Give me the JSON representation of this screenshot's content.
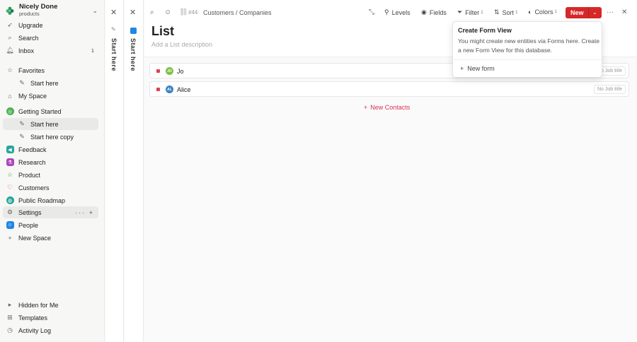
{
  "workspace": {
    "name": "Nicely Done",
    "subtitle": "products"
  },
  "sidebar": {
    "top_items": [
      {
        "label": "Upgrade",
        "icon": "rocket-icon"
      },
      {
        "label": "Search",
        "icon": "search-icon"
      },
      {
        "label": "Inbox",
        "icon": "bell-icon",
        "badge": "1"
      }
    ],
    "favorites": {
      "label": "Favorites",
      "child": "Start here"
    },
    "my_space": "My Space",
    "getting_started": {
      "label": "Getting Started",
      "children": [
        "Start here",
        "Start here copy"
      ]
    },
    "spaces": [
      "Feedback",
      "Research",
      "Product",
      "Customers",
      "Public Roadmap",
      "Settings",
      "People"
    ],
    "new_space": "New Space",
    "bottom_items": [
      "Hidden for Me",
      "Templates",
      "Activity Log"
    ]
  },
  "panels": {
    "left_label": "Start here",
    "right_label": "Start here"
  },
  "topbar": {
    "record_id": "#44",
    "breadcrumb": "Customers / Companies",
    "levels": "Levels",
    "fields": "Fields",
    "filter": "Filter",
    "filter_count": "1",
    "sort": "Sort",
    "sort_count": "1",
    "colors": "Colors",
    "colors_count": "1",
    "new": "New"
  },
  "view": {
    "title": "List",
    "description_placeholder": "Add a List description"
  },
  "records": [
    {
      "initials": "JO",
      "name": "Jo",
      "job": "No Job title",
      "avatar_color": "#7bc043"
    },
    {
      "initials": "AL",
      "name": "Alice",
      "job": "No Job title",
      "avatar_color": "#3b82c4"
    }
  ],
  "new_contacts": "New Contacts",
  "popover": {
    "title": "Create Form View",
    "description": "You might create new entities via Forms here. Create a new Form View for this database.",
    "action": "New form"
  },
  "colors": {
    "accent": "#d62828",
    "link": "#e03050"
  }
}
